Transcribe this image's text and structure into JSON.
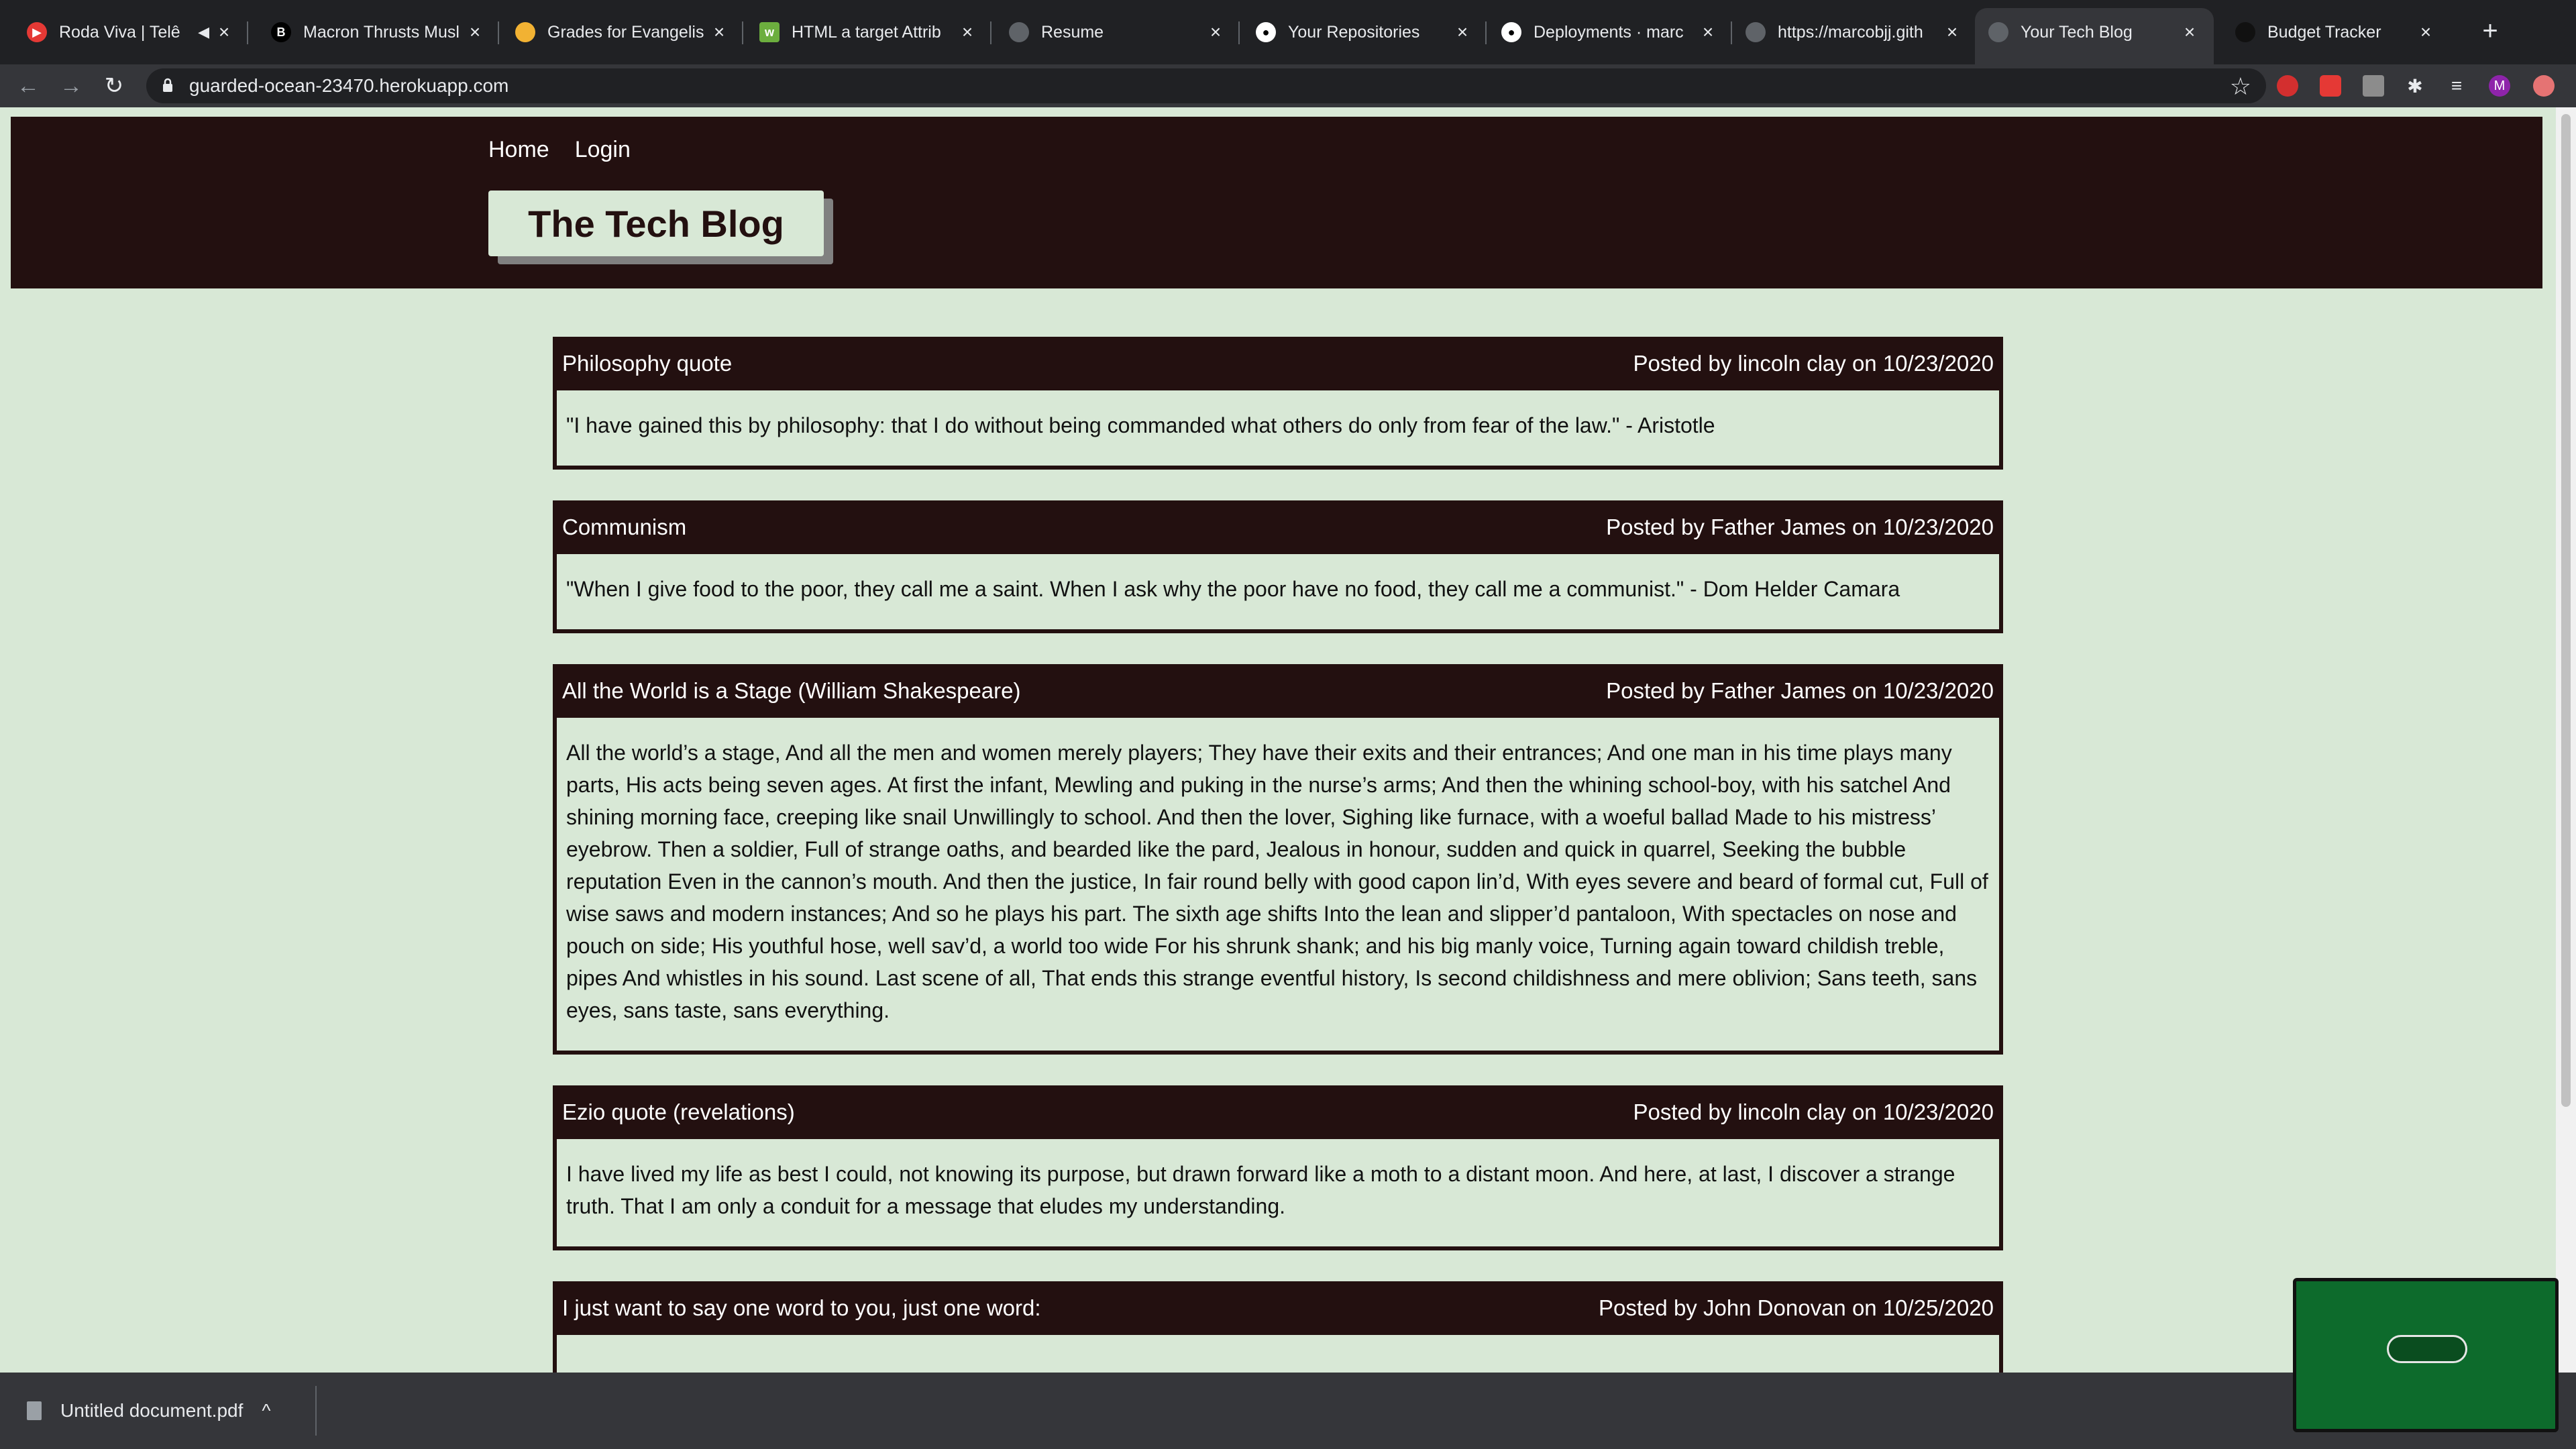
{
  "browser": {
    "tabs": [
      {
        "title": "Roda Viva | Telê",
        "favicon_color": "#e53935",
        "close": "×"
      },
      {
        "title": "Macron Thrusts Musl",
        "favicon_color": "#000000",
        "close": "×"
      },
      {
        "title": "Grades for Evangelis",
        "favicon_color": "#f2b233",
        "close": "×"
      },
      {
        "title": "HTML a target Attrib",
        "favicon_color": "#6cae3e",
        "close": "×"
      },
      {
        "title": "Resume",
        "favicon_color": "#5f6368",
        "close": "×"
      },
      {
        "title": "Your Repositories",
        "favicon_color": "#ffffff",
        "close": "×"
      },
      {
        "title": "Deployments · marc",
        "favicon_color": "#ffffff",
        "close": "×"
      },
      {
        "title": "https://marcobjj.gith",
        "favicon_color": "#5f6368",
        "close": "×"
      },
      {
        "title": "Your Tech Blog",
        "favicon_color": "#5f6368",
        "close": "×",
        "active": true
      },
      {
        "title": "Budget Tracker",
        "favicon_color": "#111111",
        "close": "×"
      }
    ],
    "new_tab": "+",
    "url": "guarded-ocean-23470.herokuapp.com",
    "profile_initial": "M"
  },
  "site": {
    "nav": {
      "home": "Home",
      "login": "Login"
    },
    "brand": "The Tech Blog"
  },
  "posts": [
    {
      "title": "Philosophy quote",
      "meta": "Posted by lincoln clay on 10/23/2020",
      "body": "\"I have gained this by philosophy: that I do without being commanded what others do only from fear of the law.\" - Aristotle"
    },
    {
      "title": "Communism",
      "meta": "Posted by Father James on 10/23/2020",
      "body": "\"When I give food to the poor, they call me a saint. When I ask why the poor have no food, they call me a communist.\" - Dom Helder Camara"
    },
    {
      "title": "All the World is a Stage (William Shakespeare)",
      "meta": "Posted by Father James on 10/23/2020",
      "body": "All the world’s a stage, And all the men and women merely players; They have their exits and their entrances; And one man in his time plays many parts, His acts being seven ages. At first the infant, Mewling and puking in the nurse’s arms; And then the whining school-boy, with his satchel And shining morning face, creeping like snail Unwillingly to school. And then the lover, Sighing like furnace, with a woeful ballad Made to his mistress’ eyebrow. Then a soldier, Full of strange oaths, and bearded like the pard, Jealous in honour, sudden and quick in quarrel, Seeking the bubble reputation Even in the cannon’s mouth. And then the justice, In fair round belly with good capon lin’d, With eyes severe and beard of formal cut, Full of wise saws and modern instances; And so he plays his part. The sixth age shifts Into the lean and slipper’d pantaloon, With spectacles on nose and pouch on side; His youthful hose, well sav’d, a world too wide For his shrunk shank; and his big manly voice, Turning again toward childish treble, pipes And whistles in his sound. Last scene of all, That ends this strange eventful history, Is second childishness and mere oblivion; Sans teeth, sans eyes, sans taste, sans everything."
    },
    {
      "title": "Ezio quote (revelations)",
      "meta": "Posted by lincoln clay on 10/23/2020",
      "body": "I have lived my life as best I could, not knowing its purpose, but drawn forward like a moth to a distant moon. And here, at last, I discover a strange truth. That I am only a conduit for a message that eludes my understanding."
    },
    {
      "title": "I just want to say one word to you, just one word:",
      "meta": "Posted by John Donovan on 10/25/2020",
      "body": ""
    }
  ],
  "downloads": {
    "file": "Untitled document.pdf",
    "chevron": "^"
  }
}
